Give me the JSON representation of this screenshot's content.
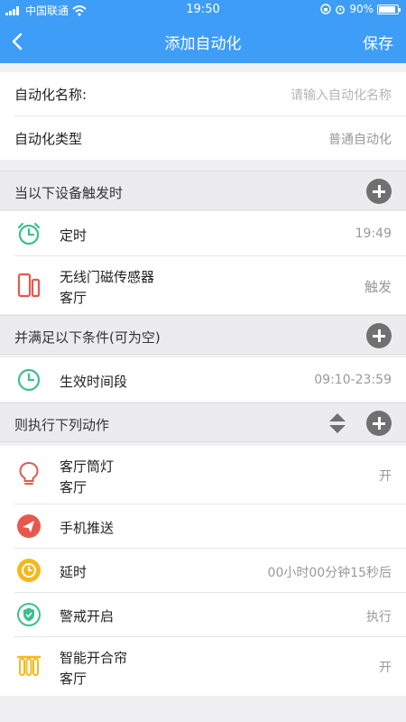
{
  "status": {
    "carrier": "中国联通",
    "time": "19:50",
    "battery": "90%"
  },
  "nav": {
    "title": "添加自动化",
    "save": "保存"
  },
  "form": {
    "name_label": "自动化名称:",
    "name_placeholder": "请输入自动化名称",
    "type_label": "自动化类型",
    "type_value": "普通自动化"
  },
  "triggers": {
    "title": "当以下设备触发时",
    "items": [
      {
        "name": "定时",
        "value": "19:49",
        "icon": "alarm-clock-icon"
      },
      {
        "name": "无线门磁传感器",
        "room": "客厅",
        "value": "触发",
        "icon": "door-sensor-icon"
      }
    ]
  },
  "conditions": {
    "title": "并满足以下条件(可为空)",
    "items": [
      {
        "name": "生效时间段",
        "value": "09:10-23:59",
        "icon": "clock-icon"
      }
    ]
  },
  "actions": {
    "title": "则执行下列动作",
    "items": [
      {
        "name": "客厅筒灯",
        "room": "客厅",
        "value": "开",
        "icon": "bulb-icon"
      },
      {
        "name": "手机推送",
        "value": "",
        "icon": "send-icon"
      },
      {
        "name": "延时",
        "value": "00小时00分钟15秒后",
        "icon": "delay-icon"
      },
      {
        "name": "警戒开启",
        "value": "执行",
        "icon": "shield-icon"
      },
      {
        "name": "智能开合帘",
        "room": "客厅",
        "value": "开",
        "icon": "curtain-icon"
      }
    ]
  },
  "colors": {
    "header": "#3d9df7",
    "green": "#3cbf8f",
    "red": "#e8574d",
    "yellow": "#f5b81c"
  }
}
